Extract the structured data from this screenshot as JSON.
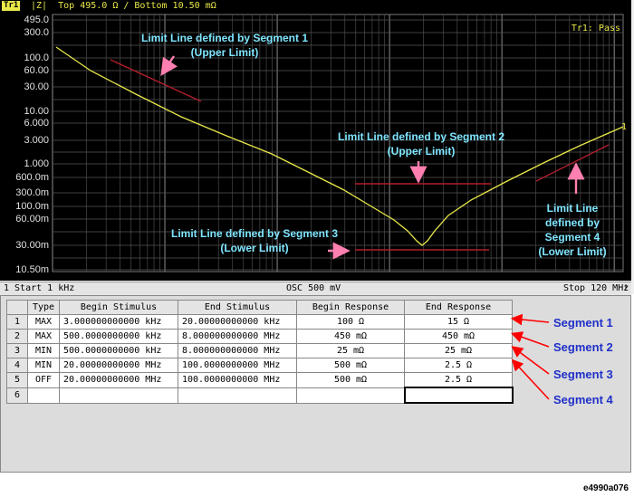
{
  "header": {
    "trace_badge": "Tr1",
    "text": " |Z|  Top 495.0 Ω / Bottom 10.50 mΩ",
    "pass_label": "Tr1: Pass"
  },
  "y_ticks": [
    "495.0",
    "300.0",
    "100.0",
    "60.00",
    "30.00",
    "10.00",
    "6.000",
    "3.000",
    "1.000",
    "600.0m",
    "300.0m",
    "100.0m",
    "60.00m",
    "30.00m",
    "10.50m"
  ],
  "marker_label": "1",
  "annotations": {
    "seg1": [
      "Limit Line defined by Segment 1",
      "(Upper Limit)"
    ],
    "seg2": [
      "Limit Line defined by Segment 2",
      "(Upper Limit)"
    ],
    "seg3": [
      "Limit Line defined by Segment 3",
      "(Lower Limit)"
    ],
    "seg4": [
      "Limit Line",
      "defined by",
      "Segment 4",
      "(Lower Limit)"
    ]
  },
  "status": {
    "left": "1  Start 1 kHz",
    "center": "OSC 500 mV",
    "right": "Stop 120 MHz",
    "excl": "!"
  },
  "table": {
    "headers": [
      "Type",
      "Begin Stimulus",
      "End Stimulus",
      "Begin Response",
      "End Response"
    ],
    "rows": [
      {
        "n": "1",
        "type": "MAX",
        "begin_stim": "3.000000000000 kHz",
        "end_stim": "20.00000000000 kHz",
        "begin_resp": "100 Ω",
        "end_resp": "15 Ω"
      },
      {
        "n": "2",
        "type": "MAX",
        "begin_stim": "500.0000000000 kHz",
        "end_stim": "8.000000000000 MHz",
        "begin_resp": "450 mΩ",
        "end_resp": "450 mΩ"
      },
      {
        "n": "3",
        "type": "MIN",
        "begin_stim": "500.0000000000 kHz",
        "end_stim": "8.000000000000 MHz",
        "begin_resp": "25 mΩ",
        "end_resp": "25 mΩ"
      },
      {
        "n": "4",
        "type": "MIN",
        "begin_stim": "20.00000000000 MHz",
        "end_stim": "100.0000000000 MHz",
        "begin_resp": "500 mΩ",
        "end_resp": "2.5 Ω"
      },
      {
        "n": "5",
        "type": "OFF",
        "begin_stim": "20.00000000000 MHz",
        "end_stim": "100.0000000000 MHz",
        "begin_resp": "500 mΩ",
        "end_resp": "2.5 Ω"
      },
      {
        "n": "6",
        "type": "",
        "begin_stim": "",
        "end_stim": "",
        "begin_resp": "",
        "end_resp": ""
      }
    ]
  },
  "segment_labels": [
    "Segment 1",
    "Segment 2",
    "Segment 3",
    "Segment 4"
  ],
  "footer_code": "e4990a076",
  "colors": {
    "trace": "#e8e84a",
    "limit": "#b01e2a",
    "annotation": "#7fe6ff",
    "arrow_pink": "#ff7fb0",
    "segment_text": "#1f2fc8",
    "arrow_red": "#ff0000"
  }
}
